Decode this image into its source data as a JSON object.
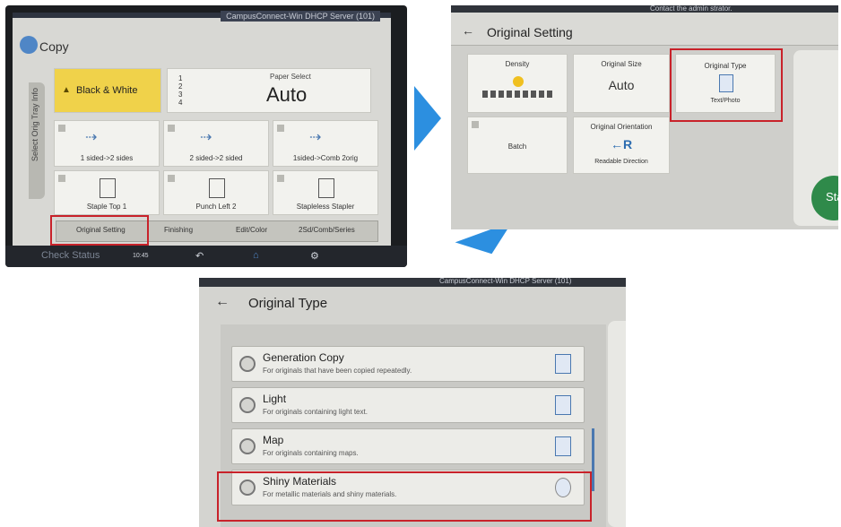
{
  "panel1": {
    "top_title": "CampusConnect-Win DHCP Server (101)",
    "app_title": "Copy",
    "side_tab": "Select Orig Tray Info",
    "color_mode": "Black & White",
    "paper_select_label": "Paper Select",
    "paper_select_value": "Auto",
    "tray_list": [
      "1",
      "2",
      "3",
      "4"
    ],
    "functions": [
      {
        "label": "1 sided->2 sides"
      },
      {
        "label": "2 sided->2 sided"
      },
      {
        "label": "1sided->Comb 2orig"
      },
      {
        "label": "Staple Top 1"
      },
      {
        "label": "Punch Left 2"
      },
      {
        "label": "Stapleless Stapler"
      }
    ],
    "tabs": [
      "Original Setting",
      "Finishing",
      "Edit/Color",
      "2Sd/Comb/Series"
    ],
    "bottom": {
      "status": "Check Status",
      "time": "10:45"
    }
  },
  "panel2": {
    "admin_text": "Contact the admin strator.",
    "title": "Original Setting",
    "tiles": [
      {
        "label": "Density",
        "value": ""
      },
      {
        "label": "Original Size",
        "value": "Auto"
      },
      {
        "label": "Original Type",
        "value": "Text/Photo"
      },
      {
        "label": "Batch",
        "value": ""
      },
      {
        "label": "Original Orientation",
        "value": "Readable Direction"
      }
    ],
    "start_button": "Sta"
  },
  "panel3": {
    "admin_text": "CampusConnect-Win DHCP Server (101)",
    "title": "Original Type",
    "options": [
      {
        "name": "Generation Copy",
        "desc": "For originals that have been copied repeatedly."
      },
      {
        "name": "Light",
        "desc": "For originals containing light text."
      },
      {
        "name": "Map",
        "desc": "For originals containing maps."
      },
      {
        "name": "Shiny Materials",
        "desc": "For metallic materials and shiny materials."
      }
    ]
  },
  "colors": {
    "highlight": "#c8222a",
    "arrow": "#2c8fe0",
    "bw_button": "#f0d24a"
  }
}
